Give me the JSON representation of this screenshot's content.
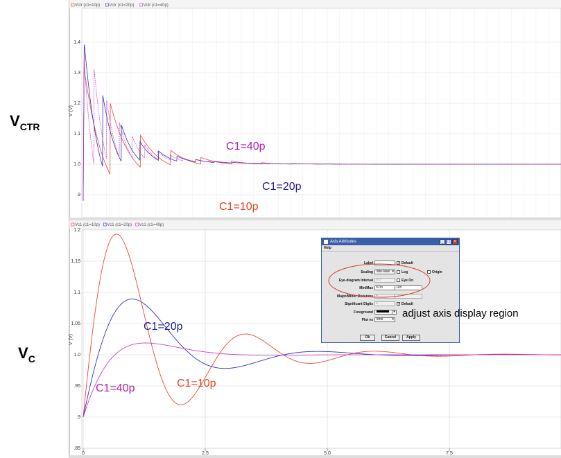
{
  "side_labels": {
    "top": {
      "main": "V",
      "sub": "CTR"
    },
    "bottom": {
      "main": "V",
      "sub": "C"
    }
  },
  "chart_data": [
    {
      "type": "line",
      "ylabel": "V (V)",
      "legend": [
        "Vctr (c1=10p)",
        "Vctr (c1=20p)",
        "Vctr (c1=40p)"
      ],
      "ylim": [
        0.85,
        1.5
      ],
      "xlim": [
        0,
        10
      ],
      "yticks": [
        {
          "v": 0.9,
          "label": ".9"
        },
        {
          "v": 1.0,
          "label": "1.0"
        },
        {
          "v": 1.1,
          "label": "1.1"
        },
        {
          "v": 1.2,
          "label": "1.2"
        },
        {
          "v": 1.3,
          "label": "1.3"
        },
        {
          "v": 1.4,
          "label": "1.4"
        }
      ],
      "annotations": [
        {
          "text": "C1=40p",
          "color": "#b020b0"
        },
        {
          "text": "C1=20p",
          "color": "#1c1c8a"
        },
        {
          "text": "C1=10p",
          "color": "#e04020"
        }
      ],
      "series": [
        {
          "name": "C1=10p",
          "color": "#e84a30"
        },
        {
          "name": "C1=20p",
          "color": "#3030c0"
        },
        {
          "name": "C1=40p",
          "color": "#cc40cc"
        }
      ]
    },
    {
      "type": "line",
      "ylabel": "V (V)",
      "legend": [
        "Vc1 (c1=10p)",
        "Vc1 (c1=20p)",
        "Vc1 (c1=40p)"
      ],
      "ylim": [
        0.85,
        1.2
      ],
      "xlim": [
        0,
        10
      ],
      "yticks": [
        {
          "v": 0.85,
          "label": ".85"
        },
        {
          "v": 0.9,
          "label": ".9"
        },
        {
          "v": 0.95,
          "label": ".95"
        },
        {
          "v": 1.0,
          "label": "1.0"
        },
        {
          "v": 1.05,
          "label": "1.05"
        },
        {
          "v": 1.1,
          "label": "1.1"
        },
        {
          "v": 1.15,
          "label": "1.15"
        },
        {
          "v": 1.2,
          "label": "1.2"
        }
      ],
      "xticks": [
        {
          "v": 0,
          "label": "0"
        },
        {
          "v": 2.5,
          "label": "2.5"
        },
        {
          "v": 5.0,
          "label": "5.0"
        },
        {
          "v": 7.5,
          "label": "7.5"
        }
      ],
      "annotations": [
        {
          "text": "C1=20p",
          "color": "#1c1c8a"
        },
        {
          "text": "C1=10p",
          "color": "#e04020"
        },
        {
          "text": "C1=40p",
          "color": "#b020b0"
        }
      ],
      "series": [
        {
          "name": "C1=10p",
          "color": "#e84a30",
          "amp": 0.3,
          "tau": 1.5,
          "period": 2.64
        },
        {
          "name": "C1=20p",
          "color": "#3030c0",
          "amp": 0.18,
          "tau": 1.35,
          "period": 3.8
        },
        {
          "name": "C1=40p",
          "color": "#cc40cc",
          "amp": 0.1,
          "tau": 0.78,
          "period": 5.2
        }
      ]
    }
  ],
  "dialog": {
    "title": "Axis Attributes",
    "menu": "Help",
    "rows": {
      "label": {
        "label": "Label",
        "value": "",
        "check": "Default"
      },
      "scaling": {
        "label": "Scaling",
        "value": "Min-Max",
        "log": "Log",
        "origin": "Origin"
      },
      "eye_interval": {
        "label": "Eye-diagram Interval",
        "value": "0.0",
        "eye": "Eye On"
      },
      "minmax": {
        "label": "Min/Max",
        "min": "0.0n",
        "max": "10n"
      },
      "divisions": {
        "label": "Major/Minor Divisions",
        "major": "4",
        "minor": "10"
      },
      "digits": {
        "label": "Significant Digits",
        "value": "4",
        "check": "Default"
      },
      "foreground": {
        "label": "Foreground"
      },
      "plotvs": {
        "label": "Plot vs",
        "value": "time"
      }
    },
    "buttons": {
      "ok": "Ok",
      "cancel": "Cancel",
      "apply": "Apply"
    }
  },
  "dialog_note": "adjust axis display region"
}
